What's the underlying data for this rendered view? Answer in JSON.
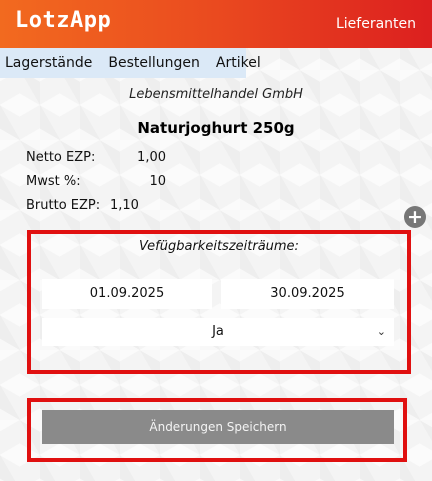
{
  "header": {
    "logo": "LotzApp",
    "supplier_link": "Lieferanten",
    "colors": {
      "gradient_start": "#f26a1f",
      "gradient_end": "#dc1f1f"
    }
  },
  "nav": {
    "items": [
      {
        "label": "Lagerstände"
      },
      {
        "label": "Bestellungen"
      },
      {
        "label": "Artikel"
      }
    ],
    "background": "#dbe9f7"
  },
  "company": "Lebensmittelhandel GmbH",
  "product": {
    "name": "Naturjoghurt 250g",
    "prices": [
      {
        "label": "Netto EZP:",
        "value": "1,00"
      },
      {
        "label": "Mwst %:",
        "value": "10"
      },
      {
        "label": "Brutto EZP:",
        "value": "1,10"
      }
    ]
  },
  "add_icon": "plus-circle-icon",
  "availability": {
    "title": "Vefügbarkeitszeiträume:",
    "start_date": "01.09.2025",
    "end_date": "30.09.2025",
    "selected": "Ja",
    "chevron_icon": "chevron-down-icon"
  },
  "save_button": "Änderungen Speichern",
  "highlight_color": "#e01010"
}
